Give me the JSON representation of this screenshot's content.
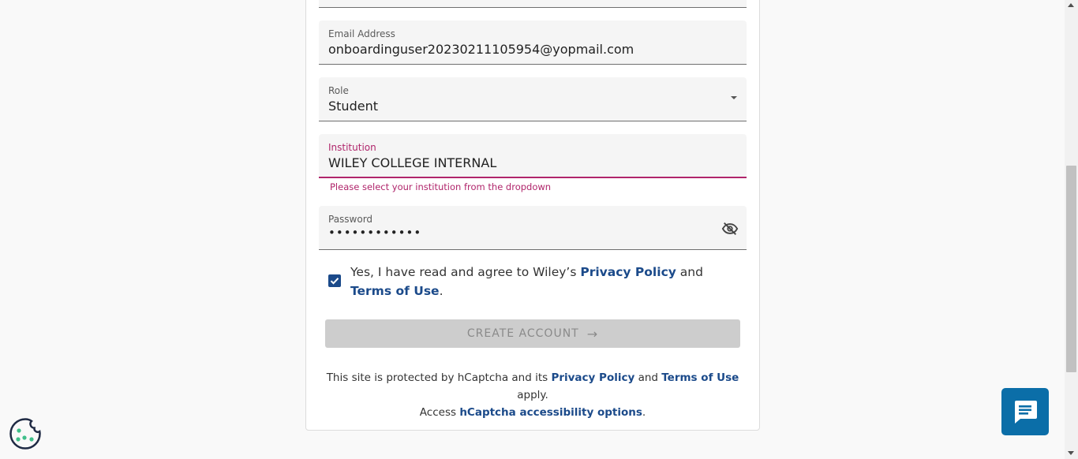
{
  "form": {
    "email": {
      "label": "Email Address",
      "value": "onboardinguser20230211105954@yopmail.com"
    },
    "role": {
      "label": "Role",
      "value": "Student"
    },
    "institution": {
      "label": "Institution",
      "value": "WILEY COLLEGE INTERNAL",
      "error": "Please select your institution from the dropdown"
    },
    "password": {
      "label": "Password",
      "value": "••••••••••••"
    }
  },
  "consent": {
    "prefix": "Yes, I have read and agree to Wiley’s ",
    "privacy": "Privacy Policy",
    "and": " and ",
    "terms": "Terms of Use",
    "suffix": "."
  },
  "submit": {
    "label": "CREATE ACCOUNT",
    "arrow": "→"
  },
  "captcha": {
    "text1": "This site is protected by hCaptcha and its ",
    "privacy": "Privacy Policy",
    "and": " and ",
    "terms": "Terms of Use",
    "text2": " apply.",
    "access": "Access ",
    "accessibility": "hCaptcha accessibility options",
    "end": "."
  },
  "colors": {
    "link": "#1b4a8a",
    "error": "#b0256b",
    "chat": "#0b6ea8"
  }
}
